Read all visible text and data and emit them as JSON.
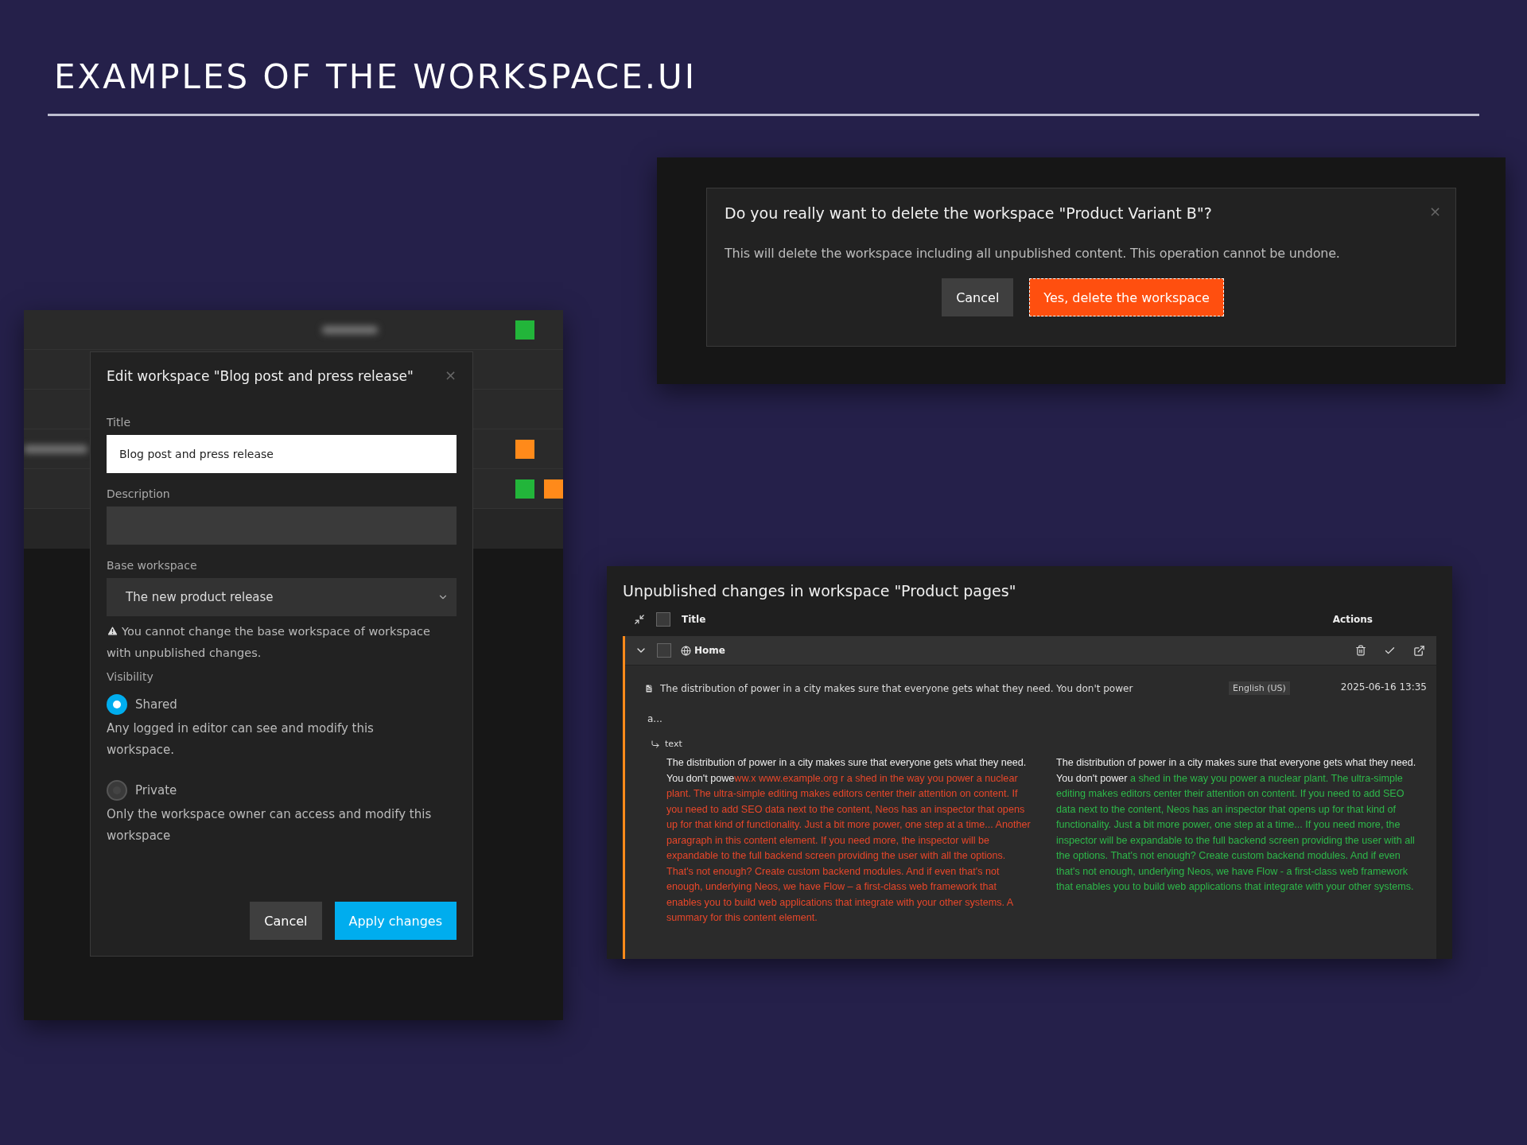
{
  "slide": {
    "title": "EXAMPLES OF THE WORKSPACE.UI"
  },
  "edit_panel": {
    "background_rows": [
      {
        "badges": [
          {
            "color": "#22b53a"
          }
        ]
      },
      {
        "badges": []
      },
      {
        "badges": []
      },
      {
        "badges": [
          {
            "color": "#ff8a1a"
          }
        ]
      },
      {
        "badges": [
          {
            "color": "#22b53a"
          },
          {
            "color": "#ff8a1a"
          }
        ]
      }
    ],
    "dialog": {
      "title": "Edit workspace \"Blog post and press release\"",
      "close": "×",
      "fields": [
        {
          "label": "Title",
          "kind": "input",
          "value": "Blog post and press release",
          "focused": true
        },
        {
          "label": "Description",
          "kind": "input",
          "focused": false
        },
        {
          "label": "Base workspace",
          "kind": "select",
          "value": "The new product release",
          "warning": "You cannot change the base workspace of workspace with unpublished changes."
        }
      ],
      "visibility": {
        "label": "Visibility",
        "options": [
          {
            "label": "Shared",
            "selected": true,
            "description": "Any logged in editor can see and modify this workspace."
          },
          {
            "label": "Private",
            "selected": false,
            "description": "Only the workspace owner can access and modify this workspace"
          }
        ]
      },
      "buttons": [
        {
          "label": "Cancel",
          "kind": "secondary"
        },
        {
          "label": "Apply changes",
          "kind": "primary"
        }
      ]
    }
  },
  "delete_dialog": {
    "title": "Do you really want to delete the workspace \"Product Variant B\"?",
    "close": "×",
    "message": "This will delete the workspace including all unpublished content. This operation cannot be undone.",
    "buttons": [
      {
        "label": "Cancel",
        "kind": "secondary"
      },
      {
        "label": "Yes, delete the workspace",
        "kind": "danger"
      }
    ]
  },
  "changes_panel": {
    "title": "Unpublished changes in workspace \"Product pages\"",
    "columns": [
      "Title",
      "Actions"
    ],
    "all_checked": false,
    "document": {
      "title": "Home",
      "expanded": true,
      "checked": false,
      "change": {
        "title_lines": [
          "The distribution of power in a city makes sure that everyone gets what they need. You don't power",
          "a..."
        ],
        "language": "English (US)",
        "date": "2025-06-16 13:35",
        "property": "text",
        "old": [
          {
            "kind": "same",
            "text": "The distribution of power in a city makes sure that everyone gets what they need. You don't powe"
          },
          {
            "kind": "removed",
            "text": "ww.x www.example.org r a shed in the way you power a nuclear plant. The ultra-simple editing makes editors center their attention on content. If you need to add SEO data next to the content, Neos has an inspector that opens up for that kind of functionality. Just a bit more power, one step at a time... Another paragraph in this content element. If you need more, the inspector will be expandable to the full backend screen providing the user with all the options. That's not enough? Create custom backend modules. And if even that's not enough, underlying Neos, we have Flow – a first-class web framework that enables you to build web applications that integrate with your other systems. A summary for this content element."
          }
        ],
        "new": [
          {
            "kind": "same",
            "text": "The distribution of power in a city makes sure that everyone gets what they need. You don't power"
          },
          {
            "kind": "added",
            "text": " a shed in the way you power a nuclear plant. The ultra-simple editing makes editors center their attention on content. If you need to add SEO data next to the content, Neos has an inspector that opens up for that kind of functionality. Just a bit more power, one step at a time... If you need more, the inspector will be expandable to the full backend screen providing the user with all the options. That's not enough? Create custom backend modules. And if even that's not enough, underlying Neos, we have Flow - a first-class web framework that enables you to build web applications that integrate with your other systems."
          }
        ]
      }
    }
  }
}
